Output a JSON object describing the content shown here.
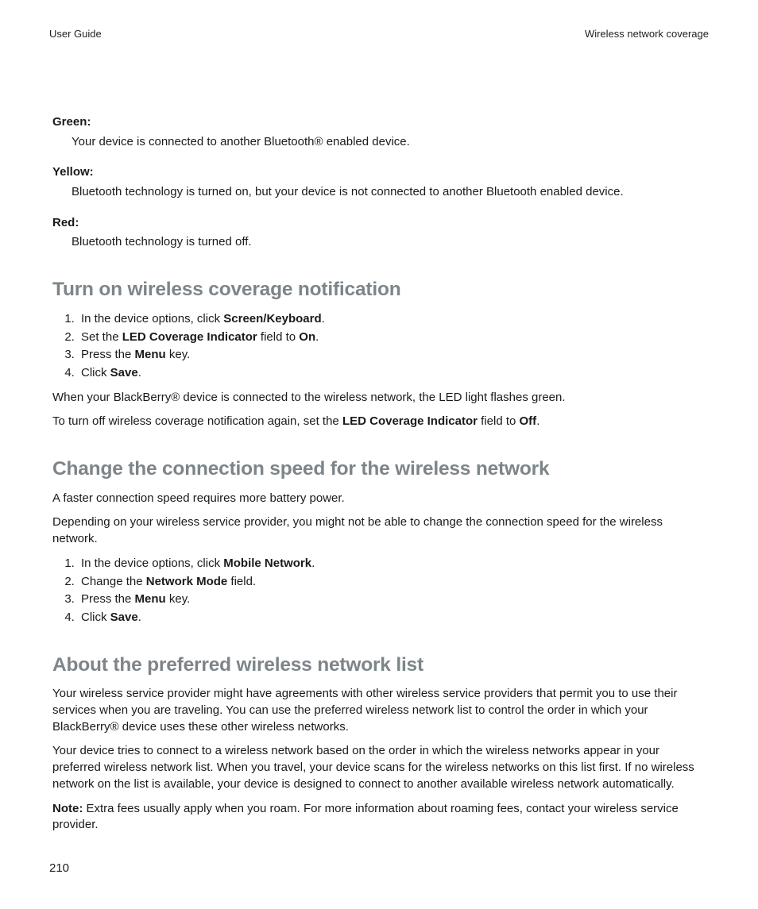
{
  "header": {
    "left": "User Guide",
    "right": "Wireless network coverage"
  },
  "definitions": [
    {
      "term": "Green:",
      "desc": "Your device is connected to another Bluetooth® enabled device."
    },
    {
      "term": "Yellow:",
      "desc": "Bluetooth technology is turned on, but your device is not connected to another Bluetooth enabled device."
    },
    {
      "term": "Red:",
      "desc": "Bluetooth technology is turned off."
    }
  ],
  "section1": {
    "heading": "Turn on wireless coverage notification",
    "steps": [
      {
        "pre": "In the device options, click ",
        "b": "Screen/Keyboard",
        "post": "."
      },
      {
        "pre": "Set the ",
        "b": "LED Coverage Indicator",
        "mid": " field to ",
        "b2": "On",
        "post": "."
      },
      {
        "pre": "Press the ",
        "b": "Menu",
        "post": " key."
      },
      {
        "pre": "Click ",
        "b": "Save",
        "post": "."
      }
    ],
    "para1": "When your BlackBerry® device is connected to the wireless network, the LED light flashes green.",
    "para2_pre": "To turn off wireless coverage notification again, set the ",
    "para2_b1": "LED Coverage Indicator",
    "para2_mid": " field to ",
    "para2_b2": "Off",
    "para2_post": "."
  },
  "section2": {
    "heading": "Change the connection speed for the wireless network",
    "para1": "A faster connection speed requires more battery power.",
    "para2": "Depending on your wireless service provider, you might not be able to change the connection speed for the wireless network.",
    "steps": [
      {
        "pre": "In the device options, click ",
        "b": "Mobile Network",
        "post": "."
      },
      {
        "pre": "Change the ",
        "b": "Network Mode",
        "post": " field."
      },
      {
        "pre": "Press the ",
        "b": "Menu",
        "post": " key."
      },
      {
        "pre": "Click ",
        "b": "Save",
        "post": "."
      }
    ]
  },
  "section3": {
    "heading": "About the preferred wireless network list",
    "para1": "Your wireless service provider might have agreements with other wireless service providers that permit you to use their services when you are traveling. You can use the preferred wireless network list to control the order in which your BlackBerry® device uses these other wireless networks.",
    "para2": "Your device tries to connect to a wireless network based on the order in which the wireless networks appear in your preferred wireless network list. When you travel, your device scans for the wireless networks on this list first. If no wireless network on the list is available, your device is designed to connect to another available wireless network automatically.",
    "note_label": "Note:",
    "note_text": "  Extra fees usually apply when you roam. For more information about roaming fees, contact your wireless service provider."
  },
  "page_number": "210"
}
